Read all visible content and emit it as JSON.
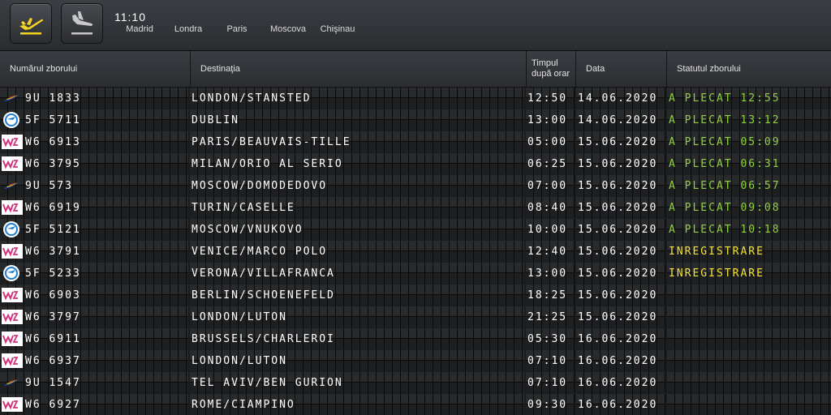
{
  "toolbar": {
    "departures_icon": "plane-takeoff-icon",
    "arrivals_icon": "plane-landing-icon"
  },
  "clock": {
    "time": "11:10",
    "cities": [
      "Madrid",
      "Londra",
      "Paris",
      "Moscova",
      "Chişinau"
    ]
  },
  "table": {
    "headers": {
      "flight": "Numărul zborului",
      "destination": "Destinaţia",
      "time": "Timpul după orar",
      "date": "Data",
      "status": "Statutul zborului"
    },
    "rows": [
      {
        "airline": "air-moldova",
        "flight": "9U 1833",
        "destination": "LONDON/STANSTED",
        "time": "12:50",
        "date": "14.06.2020",
        "status": "A PLECAT 12:55"
      },
      {
        "airline": "fly-one",
        "flight": "5F 5711",
        "destination": "DUBLIN",
        "time": "13:00",
        "date": "14.06.2020",
        "status": "A PLECAT 13:12"
      },
      {
        "airline": "wizz-air",
        "flight": "W6 6913",
        "destination": "PARIS/BEAUVAIS-TILLE",
        "time": "05:00",
        "date": "15.06.2020",
        "status": "A PLECAT 05:09"
      },
      {
        "airline": "wizz-air",
        "flight": "W6 3795",
        "destination": "MILAN/ORIO AL SERIO",
        "time": "06:25",
        "date": "15.06.2020",
        "status": "A PLECAT 06:31"
      },
      {
        "airline": "air-moldova",
        "flight": "9U 573",
        "destination": "MOSCOW/DOMODEDOVO",
        "time": "07:00",
        "date": "15.06.2020",
        "status": "A PLECAT 06:57"
      },
      {
        "airline": "wizz-air",
        "flight": "W6 6919",
        "destination": "TURIN/CASELLE",
        "time": "08:40",
        "date": "15.06.2020",
        "status": "A PLECAT 09:08"
      },
      {
        "airline": "fly-one",
        "flight": "5F 5121",
        "destination": "MOSCOW/VNUKOVO",
        "time": "10:00",
        "date": "15.06.2020",
        "status": "A PLECAT 10:18"
      },
      {
        "airline": "wizz-air",
        "flight": "W6 3791",
        "destination": "VENICE/MARCO POLO",
        "time": "12:40",
        "date": "15.06.2020",
        "status": "INREGISTRARE"
      },
      {
        "airline": "fly-one",
        "flight": "5F 5233",
        "destination": "VERONA/VILLAFRANCA",
        "time": "13:00",
        "date": "15.06.2020",
        "status": "INREGISTRARE"
      },
      {
        "airline": "wizz-air",
        "flight": "W6 6903",
        "destination": "BERLIN/SCHOENEFELD",
        "time": "18:25",
        "date": "15.06.2020",
        "status": ""
      },
      {
        "airline": "wizz-air",
        "flight": "W6 3797",
        "destination": "LONDON/LUTON",
        "time": "21:25",
        "date": "15.06.2020",
        "status": ""
      },
      {
        "airline": "wizz-air",
        "flight": "W6 6911",
        "destination": "BRUSSELS/CHARLEROI",
        "time": "05:30",
        "date": "16.06.2020",
        "status": ""
      },
      {
        "airline": "wizz-air",
        "flight": "W6 6937",
        "destination": "LONDON/LUTON",
        "time": "07:10",
        "date": "16.06.2020",
        "status": ""
      },
      {
        "airline": "air-moldova",
        "flight": "9U 1547",
        "destination": "TEL AVIV/BEN GURION",
        "time": "07:10",
        "date": "16.06.2020",
        "status": ""
      },
      {
        "airline": "wizz-air",
        "flight": "W6 6927",
        "destination": "ROME/CIAMPINO",
        "time": "09:30",
        "date": "16.06.2020",
        "status": ""
      }
    ]
  },
  "colors": {
    "departed": "#8fd13f",
    "checkin": "#f3e232",
    "text": "#ffffff",
    "icon_active": "#f5d326",
    "icon_inactive": "#c8c8c8"
  }
}
